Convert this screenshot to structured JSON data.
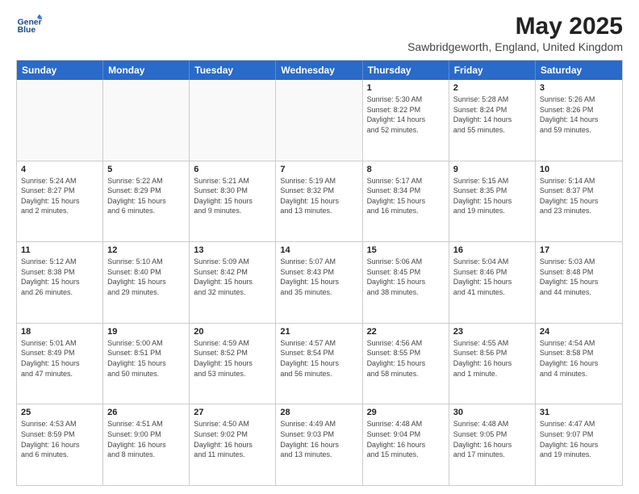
{
  "logo": {
    "line1": "General",
    "line2": "Blue"
  },
  "title": "May 2025",
  "subtitle": "Sawbridgeworth, England, United Kingdom",
  "header_days": [
    "Sunday",
    "Monday",
    "Tuesday",
    "Wednesday",
    "Thursday",
    "Friday",
    "Saturday"
  ],
  "weeks": [
    [
      {
        "day": "",
        "info": ""
      },
      {
        "day": "",
        "info": ""
      },
      {
        "day": "",
        "info": ""
      },
      {
        "day": "",
        "info": ""
      },
      {
        "day": "1",
        "info": "Sunrise: 5:30 AM\nSunset: 8:22 PM\nDaylight: 14 hours\nand 52 minutes."
      },
      {
        "day": "2",
        "info": "Sunrise: 5:28 AM\nSunset: 8:24 PM\nDaylight: 14 hours\nand 55 minutes."
      },
      {
        "day": "3",
        "info": "Sunrise: 5:26 AM\nSunset: 8:26 PM\nDaylight: 14 hours\nand 59 minutes."
      }
    ],
    [
      {
        "day": "4",
        "info": "Sunrise: 5:24 AM\nSunset: 8:27 PM\nDaylight: 15 hours\nand 2 minutes."
      },
      {
        "day": "5",
        "info": "Sunrise: 5:22 AM\nSunset: 8:29 PM\nDaylight: 15 hours\nand 6 minutes."
      },
      {
        "day": "6",
        "info": "Sunrise: 5:21 AM\nSunset: 8:30 PM\nDaylight: 15 hours\nand 9 minutes."
      },
      {
        "day": "7",
        "info": "Sunrise: 5:19 AM\nSunset: 8:32 PM\nDaylight: 15 hours\nand 13 minutes."
      },
      {
        "day": "8",
        "info": "Sunrise: 5:17 AM\nSunset: 8:34 PM\nDaylight: 15 hours\nand 16 minutes."
      },
      {
        "day": "9",
        "info": "Sunrise: 5:15 AM\nSunset: 8:35 PM\nDaylight: 15 hours\nand 19 minutes."
      },
      {
        "day": "10",
        "info": "Sunrise: 5:14 AM\nSunset: 8:37 PM\nDaylight: 15 hours\nand 23 minutes."
      }
    ],
    [
      {
        "day": "11",
        "info": "Sunrise: 5:12 AM\nSunset: 8:38 PM\nDaylight: 15 hours\nand 26 minutes."
      },
      {
        "day": "12",
        "info": "Sunrise: 5:10 AM\nSunset: 8:40 PM\nDaylight: 15 hours\nand 29 minutes."
      },
      {
        "day": "13",
        "info": "Sunrise: 5:09 AM\nSunset: 8:42 PM\nDaylight: 15 hours\nand 32 minutes."
      },
      {
        "day": "14",
        "info": "Sunrise: 5:07 AM\nSunset: 8:43 PM\nDaylight: 15 hours\nand 35 minutes."
      },
      {
        "day": "15",
        "info": "Sunrise: 5:06 AM\nSunset: 8:45 PM\nDaylight: 15 hours\nand 38 minutes."
      },
      {
        "day": "16",
        "info": "Sunrise: 5:04 AM\nSunset: 8:46 PM\nDaylight: 15 hours\nand 41 minutes."
      },
      {
        "day": "17",
        "info": "Sunrise: 5:03 AM\nSunset: 8:48 PM\nDaylight: 15 hours\nand 44 minutes."
      }
    ],
    [
      {
        "day": "18",
        "info": "Sunrise: 5:01 AM\nSunset: 8:49 PM\nDaylight: 15 hours\nand 47 minutes."
      },
      {
        "day": "19",
        "info": "Sunrise: 5:00 AM\nSunset: 8:51 PM\nDaylight: 15 hours\nand 50 minutes."
      },
      {
        "day": "20",
        "info": "Sunrise: 4:59 AM\nSunset: 8:52 PM\nDaylight: 15 hours\nand 53 minutes."
      },
      {
        "day": "21",
        "info": "Sunrise: 4:57 AM\nSunset: 8:54 PM\nDaylight: 15 hours\nand 56 minutes."
      },
      {
        "day": "22",
        "info": "Sunrise: 4:56 AM\nSunset: 8:55 PM\nDaylight: 15 hours\nand 58 minutes."
      },
      {
        "day": "23",
        "info": "Sunrise: 4:55 AM\nSunset: 8:56 PM\nDaylight: 16 hours\nand 1 minute."
      },
      {
        "day": "24",
        "info": "Sunrise: 4:54 AM\nSunset: 8:58 PM\nDaylight: 16 hours\nand 4 minutes."
      }
    ],
    [
      {
        "day": "25",
        "info": "Sunrise: 4:53 AM\nSunset: 8:59 PM\nDaylight: 16 hours\nand 6 minutes."
      },
      {
        "day": "26",
        "info": "Sunrise: 4:51 AM\nSunset: 9:00 PM\nDaylight: 16 hours\nand 8 minutes."
      },
      {
        "day": "27",
        "info": "Sunrise: 4:50 AM\nSunset: 9:02 PM\nDaylight: 16 hours\nand 11 minutes."
      },
      {
        "day": "28",
        "info": "Sunrise: 4:49 AM\nSunset: 9:03 PM\nDaylight: 16 hours\nand 13 minutes."
      },
      {
        "day": "29",
        "info": "Sunrise: 4:48 AM\nSunset: 9:04 PM\nDaylight: 16 hours\nand 15 minutes."
      },
      {
        "day": "30",
        "info": "Sunrise: 4:48 AM\nSunset: 9:05 PM\nDaylight: 16 hours\nand 17 minutes."
      },
      {
        "day": "31",
        "info": "Sunrise: 4:47 AM\nSunset: 9:07 PM\nDaylight: 16 hours\nand 19 minutes."
      }
    ]
  ]
}
